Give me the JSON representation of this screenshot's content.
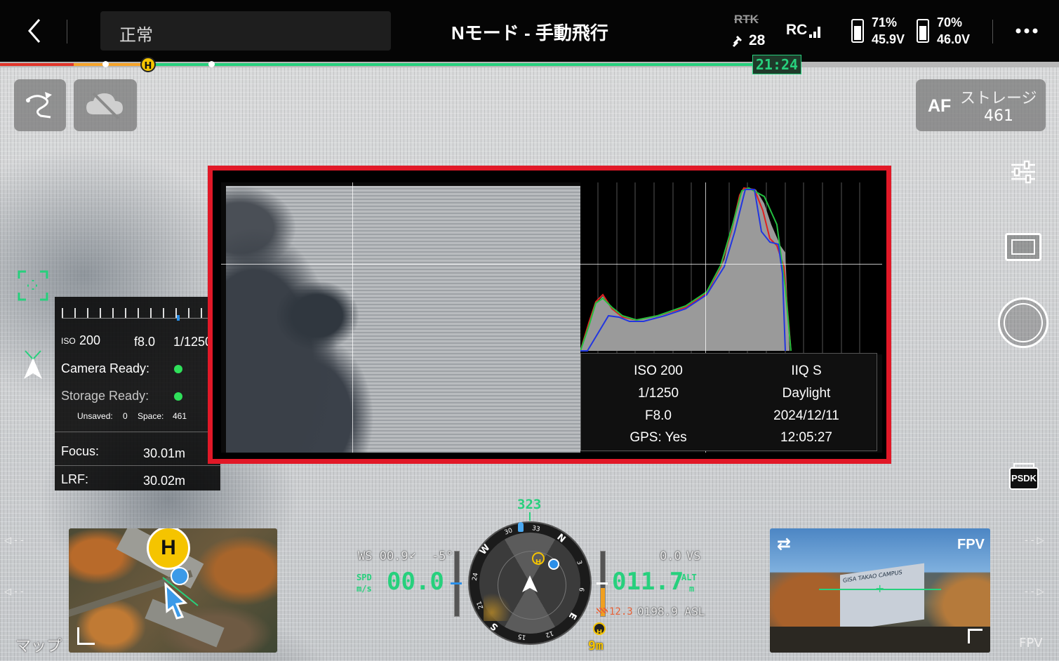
{
  "topbar": {
    "status": "正常",
    "mode_title": "Nモード - 手動飛行",
    "rtk_label": "RTK",
    "satellites": "28",
    "rc_label": "RC",
    "battery1_percent": "71%",
    "battery1_voltage": "45.9V",
    "battery2_percent": "70%",
    "battery2_voltage": "46.0V",
    "flight_time": "21:24",
    "home_marker": "H"
  },
  "camera": {
    "af_label": "AF",
    "storage_label": "ストレージ",
    "storage_count": "461"
  },
  "info_panel": {
    "iso_label": "ISO",
    "iso_value": "200",
    "aperture": "f8.0",
    "shutter": "1/1250",
    "camera_ready": "Camera Ready:",
    "storage_ready": "Storage Ready:",
    "unsaved_label": "Unsaved:",
    "unsaved_value": "0",
    "space_label": "Space:",
    "space_value": "461",
    "focus_label": "Focus:",
    "focus_value": "30.01m",
    "lrf_label": "LRF:",
    "lrf_value": "30.02m",
    "ready_color": "#2fe05a"
  },
  "photo_meta": {
    "iso": "ISO 200",
    "shutter": "1/1250",
    "aperture": "F8.0",
    "gps": "GPS: Yes",
    "camera_model": "IIQ S",
    "white_balance": "Daylight",
    "date": "2024/12/11",
    "time": "12:05:27"
  },
  "hud": {
    "heading": "323",
    "ws": "WS 00.9",
    "tilt": "-5°",
    "spd_label_1": "SPD",
    "spd_label_2": "m/s",
    "speed": "00.0",
    "vs_value": "0.0",
    "vs_label": "VS",
    "altitude": "011.7",
    "alt_label_1": "ALT",
    "alt_label_2": "m",
    "asl": "0198.9 ASL",
    "height_limit": "12.3",
    "home_distance": "9m",
    "compass_n": "N",
    "compass_e": "E",
    "compass_s": "S",
    "compass_w": "W",
    "compass_30": "30",
    "compass_33": "33",
    "compass_3": "3",
    "compass_6": "6",
    "compass_12": "12",
    "compass_15": "15",
    "compass_21": "21",
    "compass_24": "24",
    "home_marker": "H"
  },
  "map": {
    "label": "マップ",
    "home_marker": "H"
  },
  "fpv": {
    "label": "FPV",
    "corner_label": "FPV",
    "sign_text": "GISA TAKAO CAMPUS"
  },
  "side": {
    "psdk_label": "PSDK"
  },
  "colors": {
    "accent_green": "#27d07d",
    "highlight_red": "#e11827",
    "home_yellow": "#f5c400"
  }
}
